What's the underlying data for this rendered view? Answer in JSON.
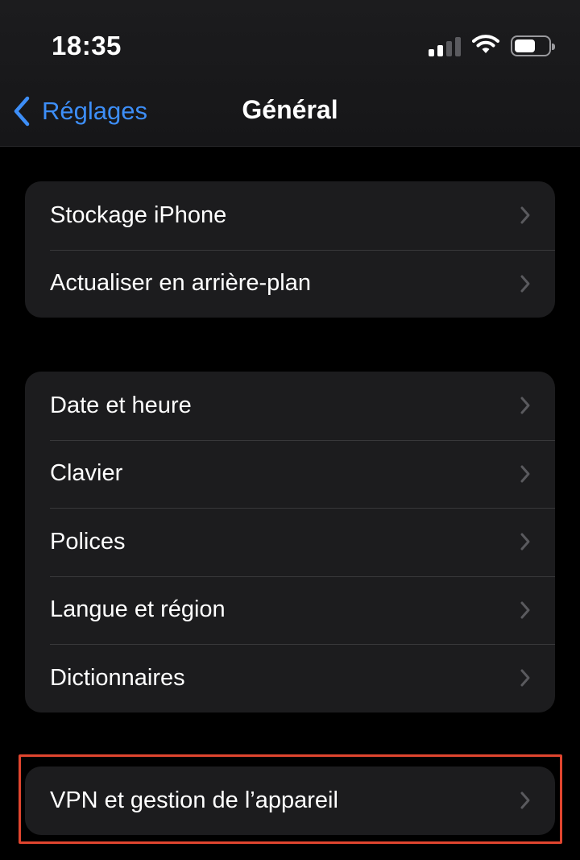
{
  "status_bar": {
    "time": "18:35",
    "signal_bars_active": 2,
    "battery_level": 0.62
  },
  "nav": {
    "back_label": "Réglages",
    "title": "Général"
  },
  "groups": [
    {
      "items": [
        {
          "label": "Stockage iPhone"
        },
        {
          "label": "Actualiser en arrière-plan"
        }
      ]
    },
    {
      "items": [
        {
          "label": "Date et heure"
        },
        {
          "label": "Clavier"
        },
        {
          "label": "Polices"
        },
        {
          "label": "Langue et région"
        },
        {
          "label": "Dictionnaires"
        }
      ]
    },
    {
      "items": [
        {
          "label": "VPN et gestion de l’appareil"
        }
      ]
    }
  ],
  "colors": {
    "accent": "#3d8ef7",
    "highlight": "#e0452f",
    "cell_background": "#1c1c1e",
    "background": "#000000"
  }
}
